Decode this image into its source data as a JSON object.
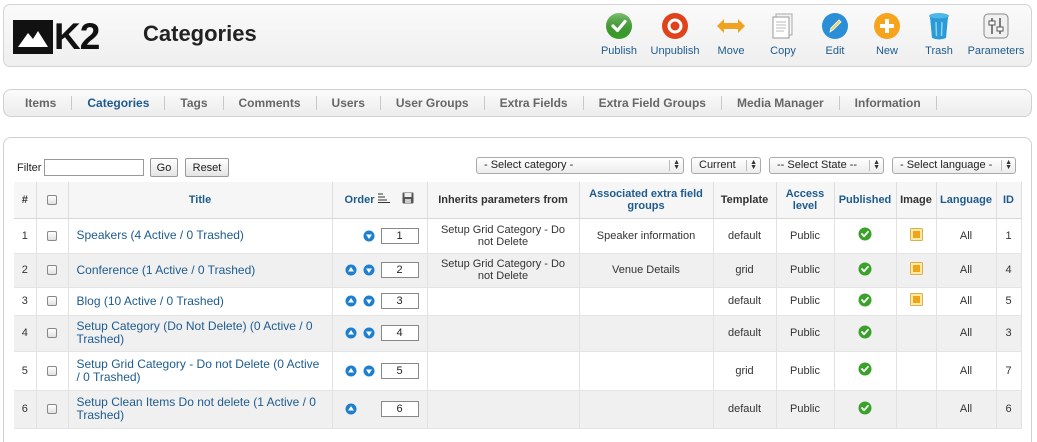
{
  "header": {
    "logo_text": "K2",
    "title": "Categories"
  },
  "toolbar": [
    {
      "label": "Publish",
      "icon": "check-circle-icon"
    },
    {
      "label": "Unpublish",
      "icon": "unpublish-circle-icon"
    },
    {
      "label": "Move",
      "icon": "move-arrows-icon"
    },
    {
      "label": "Copy",
      "icon": "copy-document-icon"
    },
    {
      "label": "Edit",
      "icon": "pencil-edit-icon"
    },
    {
      "label": "New",
      "icon": "plus-new-icon"
    },
    {
      "label": "Trash",
      "icon": "trash-can-icon"
    },
    {
      "label": "Parameters",
      "icon": "parameters-sliders-icon"
    }
  ],
  "nav": {
    "items": [
      "Items",
      "Categories",
      "Tags",
      "Comments",
      "Users",
      "User Groups",
      "Extra Fields",
      "Extra Field Groups",
      "Media Manager",
      "Information"
    ],
    "active": "Categories"
  },
  "filter": {
    "label": "Filter",
    "value": "",
    "go_label": "Go",
    "reset_label": "Reset"
  },
  "selects": {
    "category": "- Select category -",
    "current": "Current",
    "state": "-- Select State --",
    "language": "- Select language -"
  },
  "columns": {
    "num": "#",
    "title": "Title",
    "order": "Order",
    "inherits": "Inherits parameters from",
    "extra_groups": "Associated extra field groups",
    "template": "Template",
    "access": "Access level",
    "published": "Published",
    "image": "Image",
    "language": "Language",
    "id": "ID"
  },
  "rows": [
    {
      "num": "1",
      "title": "Speakers (4 Active / 0 Trashed)",
      "up": false,
      "down": true,
      "order": "1",
      "inherits": "Setup Grid Category - Do not Delete",
      "extra_groups": "Speaker information",
      "template": "default",
      "access": "Public",
      "published": true,
      "image": true,
      "language": "All",
      "id": "1"
    },
    {
      "num": "2",
      "title": "Conference (1 Active / 0 Trashed)",
      "up": true,
      "down": true,
      "order": "2",
      "inherits": "Setup Grid Category - Do not Delete",
      "extra_groups": "Venue Details",
      "template": "grid",
      "access": "Public",
      "published": true,
      "image": true,
      "language": "All",
      "id": "4"
    },
    {
      "num": "3",
      "title": "Blog (10 Active / 0 Trashed)",
      "up": true,
      "down": true,
      "order": "3",
      "inherits": "",
      "extra_groups": "",
      "template": "default",
      "access": "Public",
      "published": true,
      "image": true,
      "language": "All",
      "id": "5"
    },
    {
      "num": "4",
      "title": "Setup Category (Do Not Delete) (0 Active / 0 Trashed)",
      "up": true,
      "down": true,
      "order": "4",
      "inherits": "",
      "extra_groups": "",
      "template": "default",
      "access": "Public",
      "published": true,
      "image": false,
      "language": "All",
      "id": "3"
    },
    {
      "num": "5",
      "title": "Setup Grid Category - Do not Delete (0 Active / 0 Trashed)",
      "up": true,
      "down": true,
      "order": "5",
      "inherits": "",
      "extra_groups": "",
      "template": "grid",
      "access": "Public",
      "published": true,
      "image": false,
      "language": "All",
      "id": "7"
    },
    {
      "num": "6",
      "title": "Setup Clean Items Do not delete (1 Active / 0 Trashed)",
      "up": true,
      "down": false,
      "order": "6",
      "inherits": "",
      "extra_groups": "",
      "template": "default",
      "access": "Public",
      "published": true,
      "image": false,
      "language": "All",
      "id": "6"
    }
  ],
  "colors": {
    "link": "#1d5b8f",
    "publish_green": "#3aa12b",
    "unpublish_red": "#e0431c",
    "move_orange": "#f0a321",
    "edit_blue": "#2a8fd6",
    "new_orange": "#f7a41c",
    "arrow_blue": "#1f7fcf"
  }
}
